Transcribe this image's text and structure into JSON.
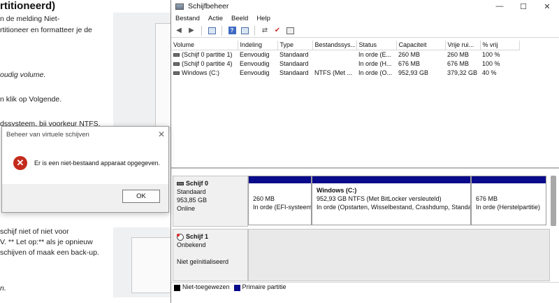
{
  "article": {
    "heading": "rtitioneerd)",
    "lines": [
      "n de melding Niet-",
      "rtitioneer en formatteer je de",
      "oudig volume.",
      "n klik op Volgende.",
      "dssysteem, bij voorkeur NTFS.",
      "schijf niet of niet voor",
      "V. ** Let op:** als je opnieuw",
      "schijven of maak een back-up.",
      "n."
    ]
  },
  "window": {
    "title": "Schijfbeheer",
    "controls": {
      "minimize": "—",
      "maximize": "☐",
      "close": "✕"
    },
    "menu": [
      "Bestand",
      "Actie",
      "Beeld",
      "Help"
    ],
    "toolbar_icons": [
      "back-arrow-icon",
      "forward-arrow-icon",
      "console-tree-icon",
      "help-icon",
      "properties-icon",
      "connect-icon",
      "checklist-icon",
      "view-icon"
    ]
  },
  "volumes": {
    "columns": [
      "Volume",
      "Indeling",
      "Type",
      "Bestandssys...",
      "Status",
      "Capaciteit",
      "Vrije rui...",
      "% vrij"
    ],
    "rows": [
      [
        "(Schijf 0 partitie 1)",
        "Eenvoudig",
        "Standaard",
        "",
        "In orde (E...",
        "260 MB",
        "260 MB",
        "100 %"
      ],
      [
        "(Schijf 0 partitie 4)",
        "Eenvoudig",
        "Standaard",
        "",
        "In orde (H...",
        "676 MB",
        "676 MB",
        "100 %"
      ],
      [
        "Windows (C:)",
        "Eenvoudig",
        "Standaard",
        "NTFS (Met ...",
        "In orde (O...",
        "952,93 GB",
        "379,32 GB",
        "40 %"
      ]
    ]
  },
  "disks": {
    "disk0": {
      "name": "Schijf 0",
      "type": "Standaard",
      "size": "953,85 GB",
      "state": "Online",
      "partitions": [
        {
          "name": "",
          "size": "260 MB",
          "status": "In orde (EFI-systeem"
        },
        {
          "name": "Windows  (C:)",
          "size": "952,93 GB NTFS (Met BitLocker versleuteld)",
          "status": "In orde (Opstarten, Wisselbestand, Crashdump, Standa"
        },
        {
          "name": "",
          "size": "676 MB",
          "status": "In orde (Herstelpartitie)"
        }
      ]
    },
    "disk1": {
      "name": "Schijf 1",
      "type": "Onbekend",
      "state": "Niet geïnitialiseerd"
    }
  },
  "legend": {
    "items": [
      {
        "label": "Niet-toegewezen",
        "color": "#000000"
      },
      {
        "label": "Primaire partitie",
        "color": "#0a0a8c"
      }
    ]
  },
  "dialog": {
    "title": "Beheer van virtuele schijven",
    "message": "Er is een niet-bestaand apparaat opgegeven.",
    "ok_label": "OK",
    "close": "✕",
    "icon": "error-icon"
  }
}
